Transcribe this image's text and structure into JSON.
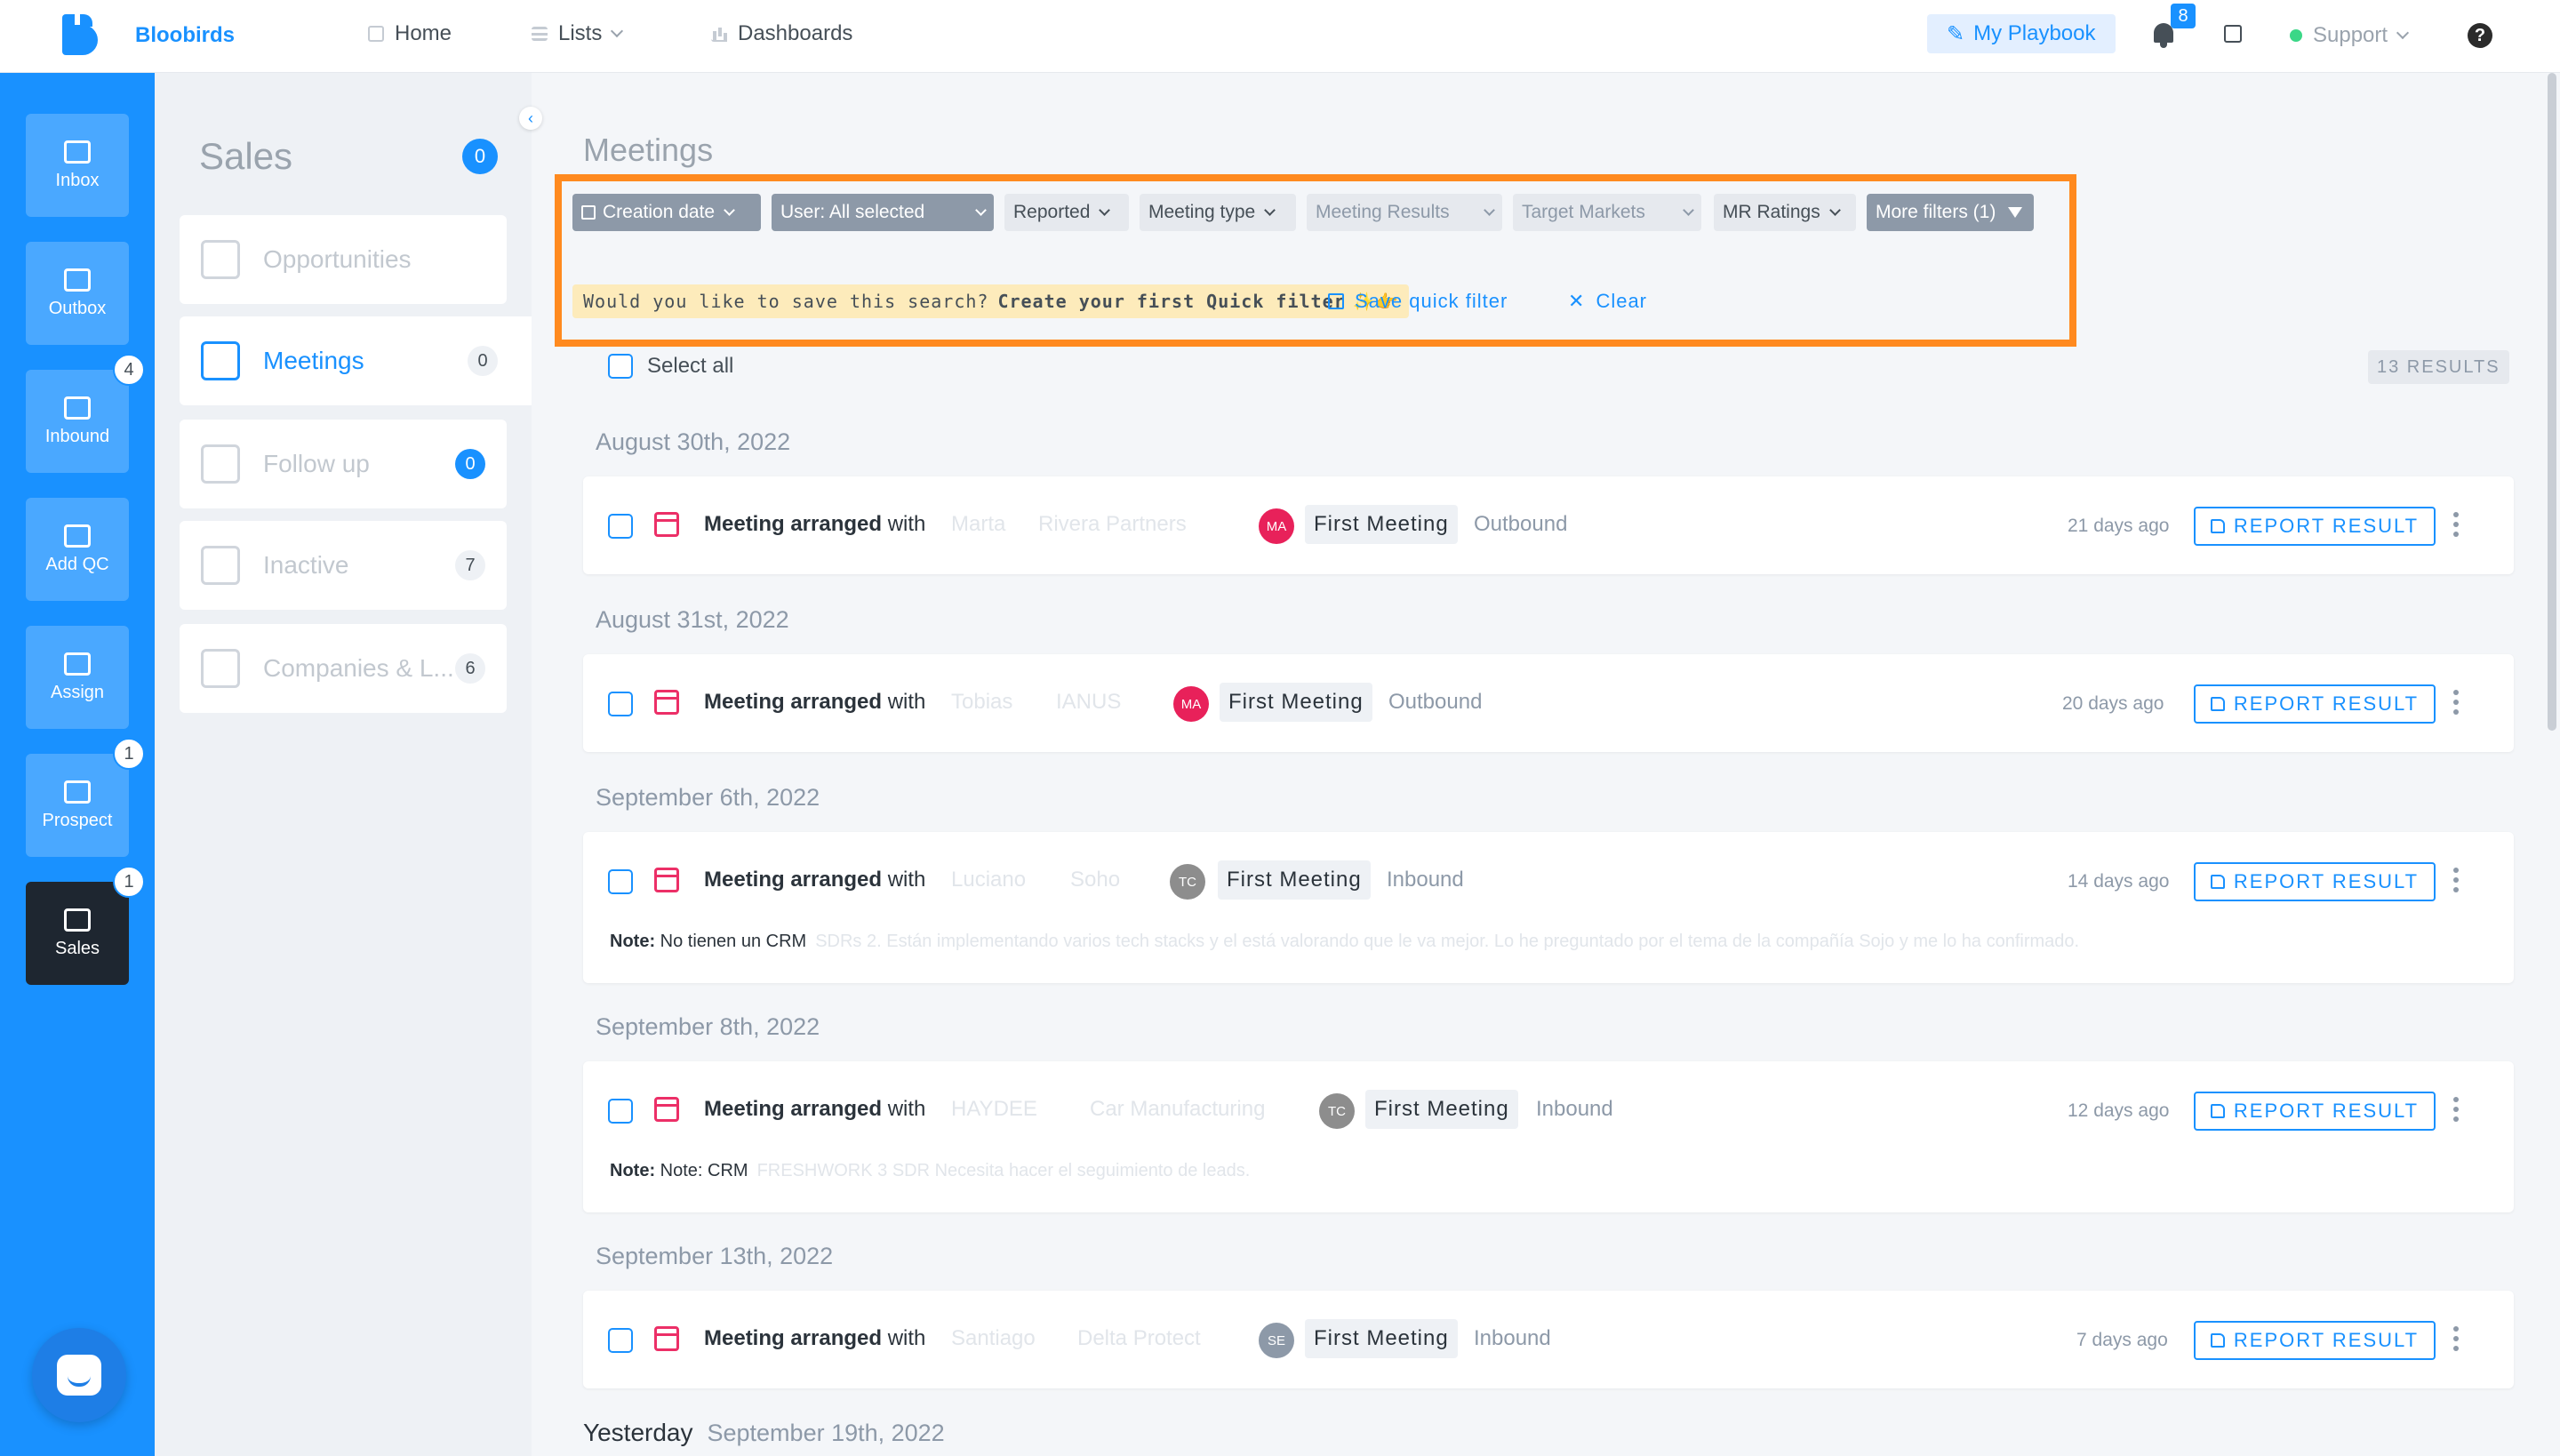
{
  "app": {
    "brand": "Bloobirds",
    "nav": {
      "home": "Home",
      "lists": "Lists",
      "dashboards": "Dashboards"
    },
    "playbook": "My Playbook",
    "notifications_count": "8",
    "support": "Support",
    "help": "?"
  },
  "rail": {
    "items": [
      {
        "label": "Inbox",
        "badge": ""
      },
      {
        "label": "Outbox",
        "badge": ""
      },
      {
        "label": "Inbound",
        "badge": "4"
      },
      {
        "label": "Add QC",
        "badge": ""
      },
      {
        "label": "Assign",
        "badge": ""
      },
      {
        "label": "Prospect",
        "badge": "1"
      },
      {
        "label": "Sales",
        "badge": "1"
      }
    ]
  },
  "sidebar": {
    "title": "Sales",
    "title_count": "0",
    "items": [
      {
        "label": "Opportunities",
        "count": ""
      },
      {
        "label": "Meetings",
        "count": "0"
      },
      {
        "label": "Follow up",
        "count": "0"
      },
      {
        "label": "Inactive",
        "count": "7"
      },
      {
        "label": "Companies & L...",
        "count": "6"
      }
    ]
  },
  "main": {
    "title": "Meetings",
    "filters": {
      "creation_date": "Creation date",
      "user": "User: All selected",
      "reported": "Reported",
      "meeting_type": "Meeting type",
      "meeting_results": "Meeting Results",
      "target_markets": "Target Markets",
      "mr_ratings": "MR Ratings",
      "more_filters": "More filters (1)"
    },
    "quick_hint_prefix": "Would you like to save this search?",
    "quick_hint_bold": "Create your first Quick filter",
    "quick_hint_emoji": "✨👉",
    "save_quick": "Save quick filter",
    "clear": "Clear",
    "select_all": "Select all",
    "results": "13 RESULTS",
    "report_label": "REPORT RESULT",
    "meeting_prefix": "Meeting arranged",
    "meeting_with": "with",
    "groups": [
      {
        "date": "August 30th, 2022",
        "item": {
          "contact": "Marta",
          "company": "Rivera Partners",
          "initials": "MA",
          "avatar_color": "#e8215a",
          "type": "First Meeting",
          "source": "Outbound",
          "ago": "21 days ago",
          "note_label": "",
          "note": "",
          "note_faded": ""
        }
      },
      {
        "date": "August 31st, 2022",
        "item": {
          "contact": "Tobias",
          "company": "IANUS",
          "initials": "MA",
          "avatar_color": "#e8215a",
          "type": "First Meeting",
          "source": "Outbound",
          "ago": "20 days ago",
          "note_label": "",
          "note": "",
          "note_faded": ""
        }
      },
      {
        "date": "September 6th, 2022",
        "item": {
          "contact": "Luciano",
          "company": "Soho",
          "initials": "TC",
          "avatar_color": "#8d8d8d",
          "type": "First Meeting",
          "source": "Inbound",
          "ago": "14 days ago",
          "note_label": "Note:",
          "note": "No tienen un CRM",
          "note_faded": "SDRs 2. Están implementando varios tech stacks y el está valorando que le va mejor. Lo he preguntado por el tema de la compañía Sojo y me lo ha confirmado."
        }
      },
      {
        "date": "September 8th, 2022",
        "item": {
          "contact": "HAYDEE",
          "company": "Car Manufacturing",
          "initials": "TC",
          "avatar_color": "#8d8d8d",
          "type": "First Meeting",
          "source": "Inbound",
          "ago": "12 days ago",
          "note_label": "Note:",
          "note": "Note: CRM",
          "note_faded": "FRESHWORK 3 SDR Necesita hacer el seguimiento de leads."
        }
      },
      {
        "date": "September 13th, 2022",
        "item": {
          "contact": "Santiago",
          "company": "Delta Protect",
          "initials": "SE",
          "avatar_color": "#8d99a8",
          "type": "First Meeting",
          "source": "Inbound",
          "ago": "7 days ago",
          "note_label": "",
          "note": "",
          "note_faded": ""
        }
      }
    ],
    "last_header": {
      "label": "Yesterday",
      "date": "September 19th, 2022"
    }
  }
}
